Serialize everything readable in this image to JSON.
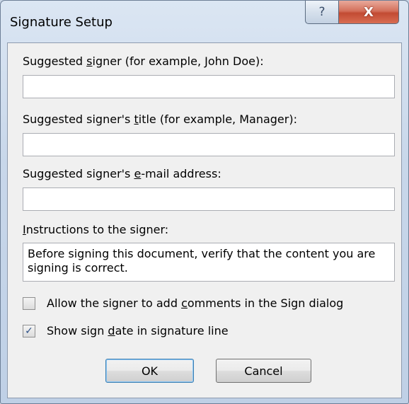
{
  "window": {
    "title": "Signature Setup",
    "help_glyph": "?",
    "close_glyph": "X"
  },
  "fields": {
    "signer": {
      "label_pre": "Suggested ",
      "label_key": "s",
      "label_post": "igner (for example, John Doe):",
      "value": ""
    },
    "title": {
      "label_pre": "Suggested signer's ",
      "label_key": "t",
      "label_post": "itle (for example, Manager):",
      "value": ""
    },
    "email": {
      "label_pre": "Suggested signer's ",
      "label_key": "e",
      "label_post": "-mail address:",
      "value": ""
    },
    "instructions": {
      "label_pre": "",
      "label_key": "I",
      "label_post": "nstructions to the signer:",
      "value": "Before signing this document, verify that the content you are signing is correct."
    }
  },
  "options": {
    "allow_comments": {
      "checked": false,
      "glyph": "",
      "label_pre": "Allow the signer to add ",
      "label_key": "c",
      "label_post": "omments in the Sign dialog"
    },
    "show_date": {
      "checked": true,
      "glyph": "✓",
      "label_pre": "Show sign ",
      "label_key": "d",
      "label_post": "ate in signature line"
    }
  },
  "buttons": {
    "ok": "OK",
    "cancel": "Cancel"
  }
}
